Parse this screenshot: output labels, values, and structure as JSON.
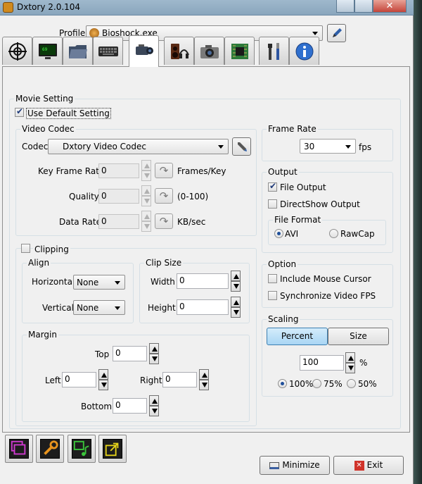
{
  "window": {
    "title": "Dxtory 2.0.104"
  },
  "profile": {
    "label": "Profile",
    "value": "Bioshock.exe"
  },
  "tabs": [
    {
      "icon": "crosshair-icon"
    },
    {
      "icon": "monitor-icon"
    },
    {
      "icon": "folder-icon"
    },
    {
      "icon": "keyboard-icon"
    },
    {
      "icon": "camcorder-icon"
    },
    {
      "icon": "speaker-headphones-icon"
    },
    {
      "icon": "camera-icon"
    },
    {
      "icon": "chip-icon"
    },
    {
      "icon": "tools-icon"
    },
    {
      "icon": "info-icon"
    }
  ],
  "movie": {
    "title": "Movie Setting",
    "use_default": "Use Default Setting",
    "video_codec": {
      "title": "Video Codec",
      "codec_label": "Codec",
      "codec_value": "Dxtory Video Codec",
      "key_frame_label": "Key Frame Rate",
      "key_frame_value": "0",
      "key_frame_unit": "Frames/Key",
      "quality_label": "Quality",
      "quality_value": "0",
      "quality_unit": "(0-100)",
      "data_rate_label": "Data Rate",
      "data_rate_value": "0",
      "data_rate_unit": "KB/sec"
    },
    "clipping": {
      "title": "Clipping",
      "align": {
        "title": "Align",
        "horizontal_label": "Horizontal",
        "horizontal_value": "None",
        "vertical_label": "Vertical",
        "vertical_value": "None"
      },
      "clip_size": {
        "title": "Clip Size",
        "width_label": "Width",
        "width_value": "0",
        "height_label": "Height",
        "height_value": "0"
      },
      "margin": {
        "title": "Margin",
        "top_label": "Top",
        "top_value": "0",
        "left_label": "Left",
        "left_value": "0",
        "right_label": "Right",
        "right_value": "0",
        "bottom_label": "Bottom",
        "bottom_value": "0"
      }
    }
  },
  "frame_rate": {
    "title": "Frame Rate",
    "value": "30",
    "unit": "fps"
  },
  "output": {
    "title": "Output",
    "file_output": "File Output",
    "directshow_output": "DirectShow Output",
    "file_format": {
      "title": "File Format",
      "avi": "AVI",
      "rawcap": "RawCap"
    }
  },
  "option": {
    "title": "Option",
    "include_mouse": "Include Mouse Cursor",
    "sync_fps": "Synchronize Video FPS"
  },
  "scaling": {
    "title": "Scaling",
    "percent_btn": "Percent",
    "size_btn": "Size",
    "value": "100",
    "unit": "%",
    "opt100": "100%",
    "opt75": "75%",
    "opt50": "50%"
  },
  "bottom": {
    "minimize": "Minimize",
    "exit": "Exit"
  },
  "colors": {
    "title_bar": "#9fb8cc",
    "selected_button": "#b6dcf5"
  }
}
